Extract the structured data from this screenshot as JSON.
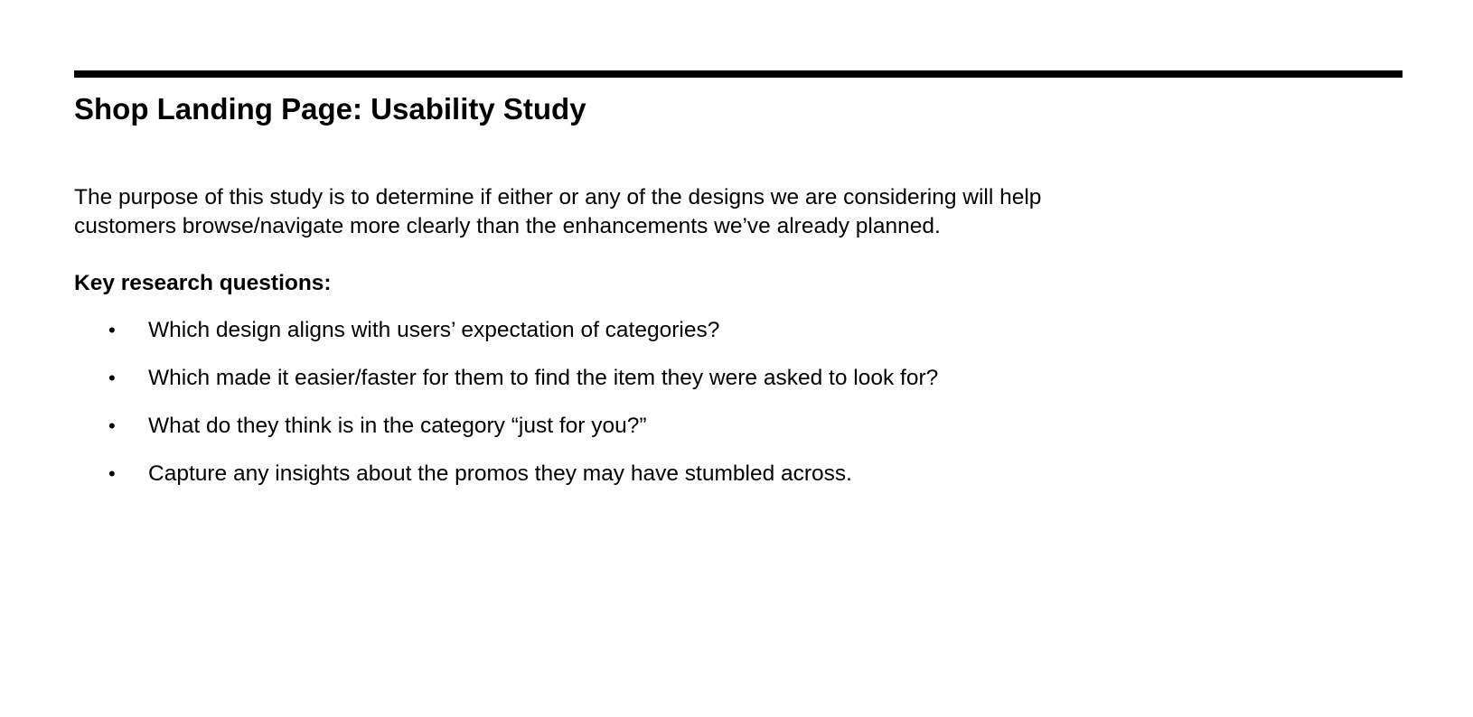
{
  "document": {
    "title": "Shop Landing Page: Usability Study",
    "intro_line_1": "The purpose of this study is to determine if either or any of the designs we are considering will help",
    "intro_line_2": "customers browse/navigate more clearly than the enhancements we’ve already planned.",
    "section_heading": "Key research questions:",
    "bullet_glyph": "•",
    "questions": [
      "Which design aligns with users’ expectation of categories?",
      "Which made it easier/faster for them to find the item they were asked to look for?",
      "What do they think is in the category “just for you?”",
      "Capture any insights about the promos they may have stumbled across."
    ]
  }
}
